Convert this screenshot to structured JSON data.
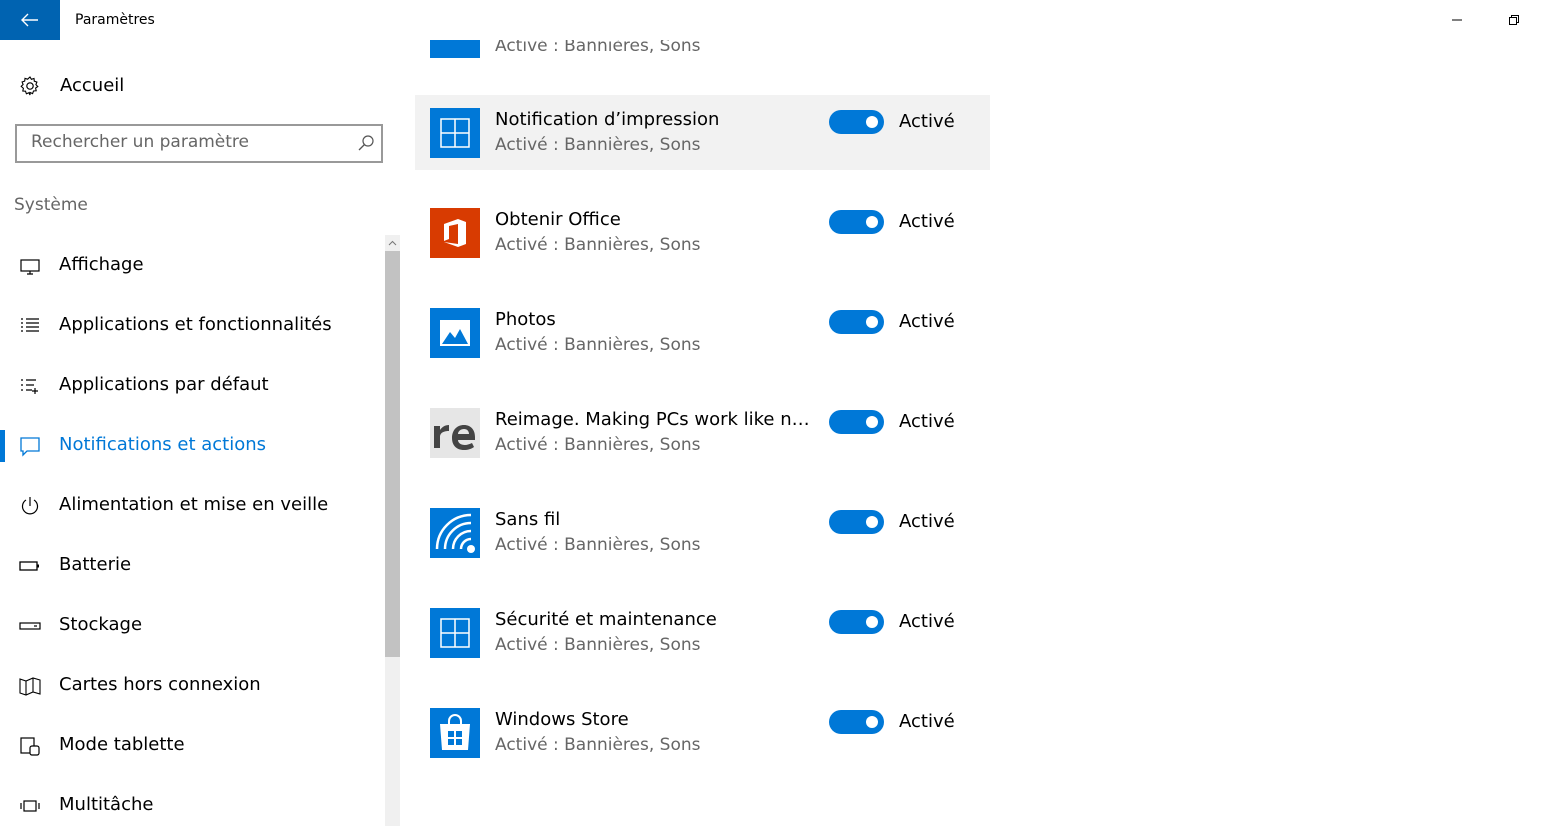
{
  "window": {
    "title": "Paramètres"
  },
  "sidebar": {
    "home_label": "Accueil",
    "search_placeholder": "Rechercher un paramètre",
    "section_label": "Système",
    "items": [
      {
        "label": "Affichage",
        "icon": "display-icon"
      },
      {
        "label": "Applications et fonctionnalités",
        "icon": "apps-list-icon"
      },
      {
        "label": "Applications par défaut",
        "icon": "default-apps-icon"
      },
      {
        "label": "Notifications et actions",
        "icon": "notification-icon",
        "active": true
      },
      {
        "label": "Alimentation et mise en veille",
        "icon": "power-icon"
      },
      {
        "label": "Batterie",
        "icon": "battery-icon"
      },
      {
        "label": "Stockage",
        "icon": "storage-icon"
      },
      {
        "label": "Cartes hors connexion",
        "icon": "map-icon"
      },
      {
        "label": "Mode tablette",
        "icon": "tablet-mode-icon"
      },
      {
        "label": "Multitâche",
        "icon": "multitask-icon"
      }
    ]
  },
  "main": {
    "partial_row": {
      "subtitle": "Activé : Bannières, Sons"
    },
    "apps": [
      {
        "name": "Notification d’impression",
        "subtitle": "Activé : Bannières, Sons",
        "state": "Activé",
        "icon": "print-notification-icon"
      },
      {
        "name": "Obtenir Office",
        "subtitle": "Activé : Bannières, Sons",
        "state": "Activé",
        "icon": "office-icon"
      },
      {
        "name": "Photos",
        "subtitle": "Activé : Bannières, Sons",
        "state": "Activé",
        "icon": "photos-icon"
      },
      {
        "name": "Reimage. Making PCs work like new,...",
        "subtitle": "Activé : Bannières, Sons",
        "state": "Activé",
        "icon": "reimage-icon"
      },
      {
        "name": "Sans fil",
        "subtitle": "Activé : Bannières, Sons",
        "state": "Activé",
        "icon": "wireless-icon"
      },
      {
        "name": "Sécurité et maintenance",
        "subtitle": "Activé : Bannières, Sons",
        "state": "Activé",
        "icon": "security-maintenance-icon"
      },
      {
        "name": "Windows Store",
        "subtitle": "Activé : Bannières, Sons",
        "state": "Activé",
        "icon": "store-icon"
      }
    ]
  },
  "colors": {
    "accent": "#0078d7",
    "back_button": "#0063b1",
    "office": "#d83b01"
  }
}
